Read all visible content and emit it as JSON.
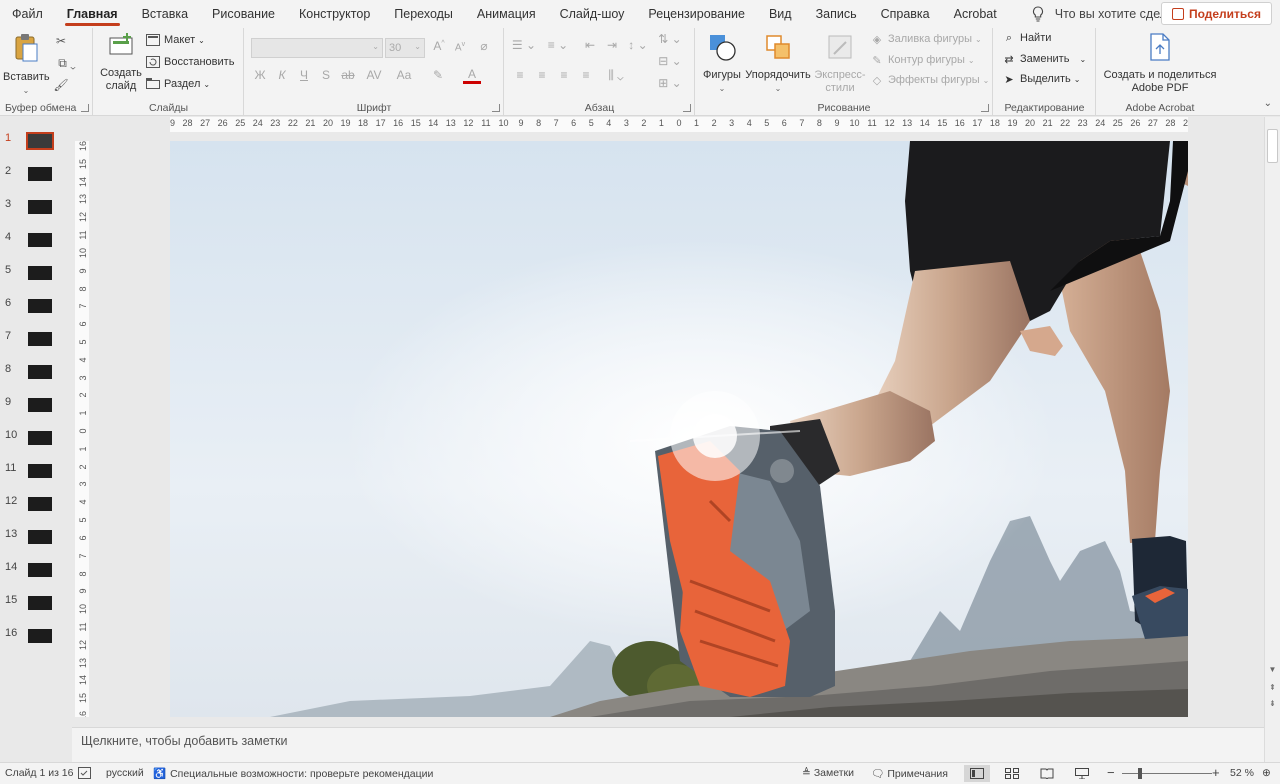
{
  "menu": {
    "tabs": [
      "Файл",
      "Главная",
      "Вставка",
      "Рисование",
      "Конструктор",
      "Переходы",
      "Анимация",
      "Слайд-шоу",
      "Рецензирование",
      "Вид",
      "Запись",
      "Справка",
      "Acrobat"
    ],
    "active_tab": "Главная",
    "tell_me": "Что вы хотите сделать?",
    "share": "Поделиться"
  },
  "ribbon": {
    "clipboard": {
      "paste": "Вставить",
      "label": "Буфер обмена"
    },
    "slides": {
      "new_slide_1": "Создать",
      "new_slide_2": "слайд",
      "layout": "Макет",
      "reset": "Восстановить",
      "section": "Раздел",
      "label": "Слайды"
    },
    "font": {
      "size": "30",
      "bold": "Ж",
      "italic": "К",
      "underline": "Ч",
      "shadow": "S",
      "strike": "ab",
      "spacing": "AV",
      "case": "Aa",
      "grow": "A",
      "shrink": "A",
      "label": "Шрифт"
    },
    "paragraph": {
      "label": "Абзац"
    },
    "drawing": {
      "shapes": "Фигуры",
      "arrange": "Упорядочить",
      "quick_styles_1": "Экспресс-",
      "quick_styles_2": "стили",
      "fill": "Заливка фигуры",
      "outline": "Контур фигуры",
      "effects": "Эффекты фигуры",
      "label": "Рисование"
    },
    "editing": {
      "find": "Найти",
      "replace": "Заменить",
      "select": "Выделить",
      "label": "Редактирование"
    },
    "acrobat": {
      "create_1": "Создать и поделиться",
      "create_2": "Adobe PDF",
      "label": "Adobe Acrobat"
    }
  },
  "thumbnails": [
    "1",
    "2",
    "3",
    "4",
    "5",
    "6",
    "7",
    "8",
    "9",
    "10",
    "11",
    "12",
    "13",
    "14",
    "15",
    "16"
  ],
  "active_slide": 1,
  "ruler_h": [
    "29",
    "28",
    "27",
    "26",
    "25",
    "24",
    "23",
    "22",
    "21",
    "20",
    "19",
    "18",
    "17",
    "16",
    "15",
    "14",
    "13",
    "12",
    "11",
    "10",
    "9",
    "8",
    "7",
    "6",
    "5",
    "4",
    "3",
    "2",
    "1",
    "0",
    "1",
    "2",
    "3",
    "4",
    "5",
    "6",
    "7",
    "8",
    "9",
    "10",
    "11",
    "12",
    "13",
    "14",
    "15",
    "16",
    "17",
    "18",
    "19",
    "20",
    "21",
    "22",
    "23",
    "24",
    "25",
    "26",
    "27",
    "28",
    "29"
  ],
  "ruler_v": [
    "16",
    "15",
    "14",
    "13",
    "12",
    "11",
    "10",
    "9",
    "8",
    "7",
    "6",
    "5",
    "4",
    "3",
    "2",
    "1",
    "0",
    "1",
    "2",
    "3",
    "4",
    "5",
    "6",
    "7",
    "8",
    "9",
    "10",
    "11",
    "12",
    "13",
    "14",
    "15",
    "16"
  ],
  "notes_placeholder": "Щелкните, чтобы добавить заметки",
  "status": {
    "slide_info": "Слайд 1 из 16",
    "language": "русский",
    "accessibility": "Специальные возможности: проверьте рекомендации",
    "notes": "Заметки",
    "comments": "Примечания",
    "zoom": "52 %",
    "zoom_minus": "−",
    "zoom_plus": "+"
  },
  "colors": {
    "accent": "#c43e1c",
    "sky": "#dde8f2",
    "shoe_sole": "#e8643a"
  }
}
